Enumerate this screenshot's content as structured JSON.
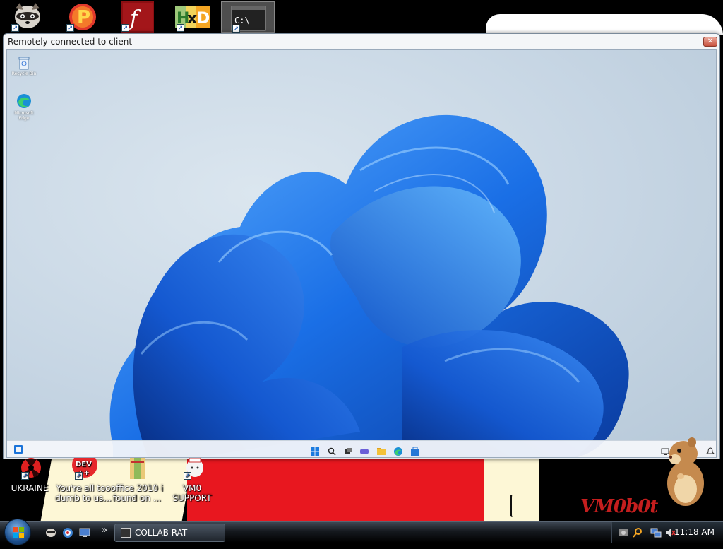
{
  "host_desktop": {
    "top_icons": [
      {
        "name": "raccoon"
      },
      {
        "name": "pdf-p"
      },
      {
        "name": "flash"
      },
      {
        "name": "hxd"
      },
      {
        "name": "cmd"
      }
    ],
    "bottom_icons": [
      {
        "label": "UKRAINE"
      },
      {
        "label": "You're all too dumb to us..."
      },
      {
        "label": "office 2010 i found on ..."
      },
      {
        "label": "VM0 SUPPORT"
      }
    ],
    "logo_text": "VM0b0t"
  },
  "remote_window": {
    "title": "Remotely connected to client",
    "close_label": "✕",
    "desktop_icons": [
      {
        "label": "Recycle Bin"
      },
      {
        "label": "Microsoft Edge"
      }
    ]
  },
  "taskbar": {
    "quicklaunch_more": "»",
    "active_window_label": "COLLAB RAT",
    "clock": "11:18 AM"
  },
  "colors": {
    "wallpaper_bloom": "#1a6fe6",
    "host_red": "#e8171f",
    "logo_red": "#c41e1e"
  }
}
